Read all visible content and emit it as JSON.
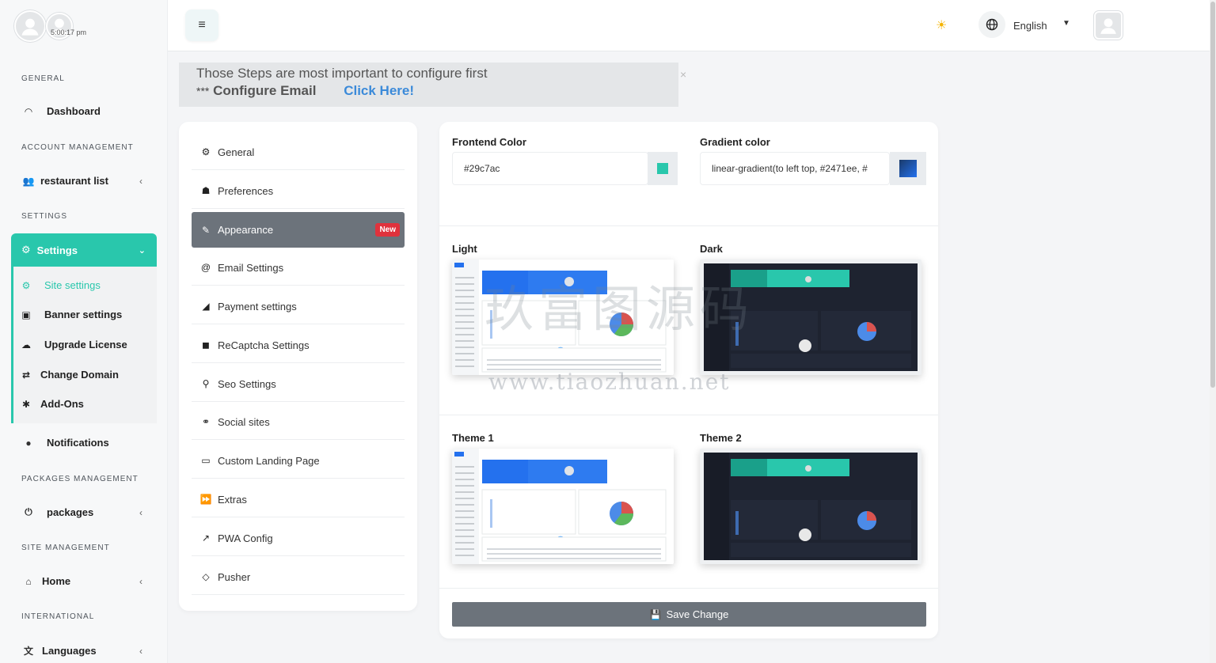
{
  "sidebar": {
    "time": "5:00:17 pm",
    "sections": {
      "general": "GENERAL",
      "account": "ACCOUNT MANAGEMENT",
      "settings": "SETTINGS",
      "packages": "PACKAGES MANAGEMENT",
      "site": "SITE MANAGEMENT",
      "international": "INTERNATIONAL"
    },
    "dashboard": "Dashboard",
    "restaurant_list": "restaurant list",
    "settings": "Settings",
    "submenu": [
      "Site settings",
      "Banner settings",
      "Upgrade License",
      "Change Domain",
      "Add-Ons"
    ],
    "notifications": "Notifications",
    "packages": "packages",
    "home": "Home",
    "languages": "Languages"
  },
  "topbar": {
    "language": "English"
  },
  "alert": {
    "line1": "Those Steps are most important to configure first",
    "prefix": "***",
    "step": "Configure Email",
    "link": "Click Here!",
    "close": "×"
  },
  "settings_menu": {
    "items": [
      "General",
      "Preferences",
      "Appearance",
      "Email Settings",
      "Payment settings",
      "ReCaptcha Settings",
      "Seo Settings",
      "Social sites",
      "Custom Landing Page",
      "Extras",
      "PWA Config",
      "Pusher"
    ],
    "badge": "New"
  },
  "appearance": {
    "frontend_label": "Frontend Color",
    "frontend_value": "#29c7ac",
    "gradient_label": "Gradient color",
    "gradient_value": "linear-gradient(to left top, #2471ee, #",
    "themes": [
      "Light",
      "Dark",
      "Theme 1",
      "Theme 2"
    ],
    "save": "Save Change"
  },
  "watermark": {
    "cn": "玖富图源码",
    "url": "www.tiaozhuan.net"
  },
  "colors": {
    "accent": "#29c7ac",
    "gradient_swatch": "#2471ee",
    "button": "#6c737b",
    "badge": "#e0323c"
  }
}
